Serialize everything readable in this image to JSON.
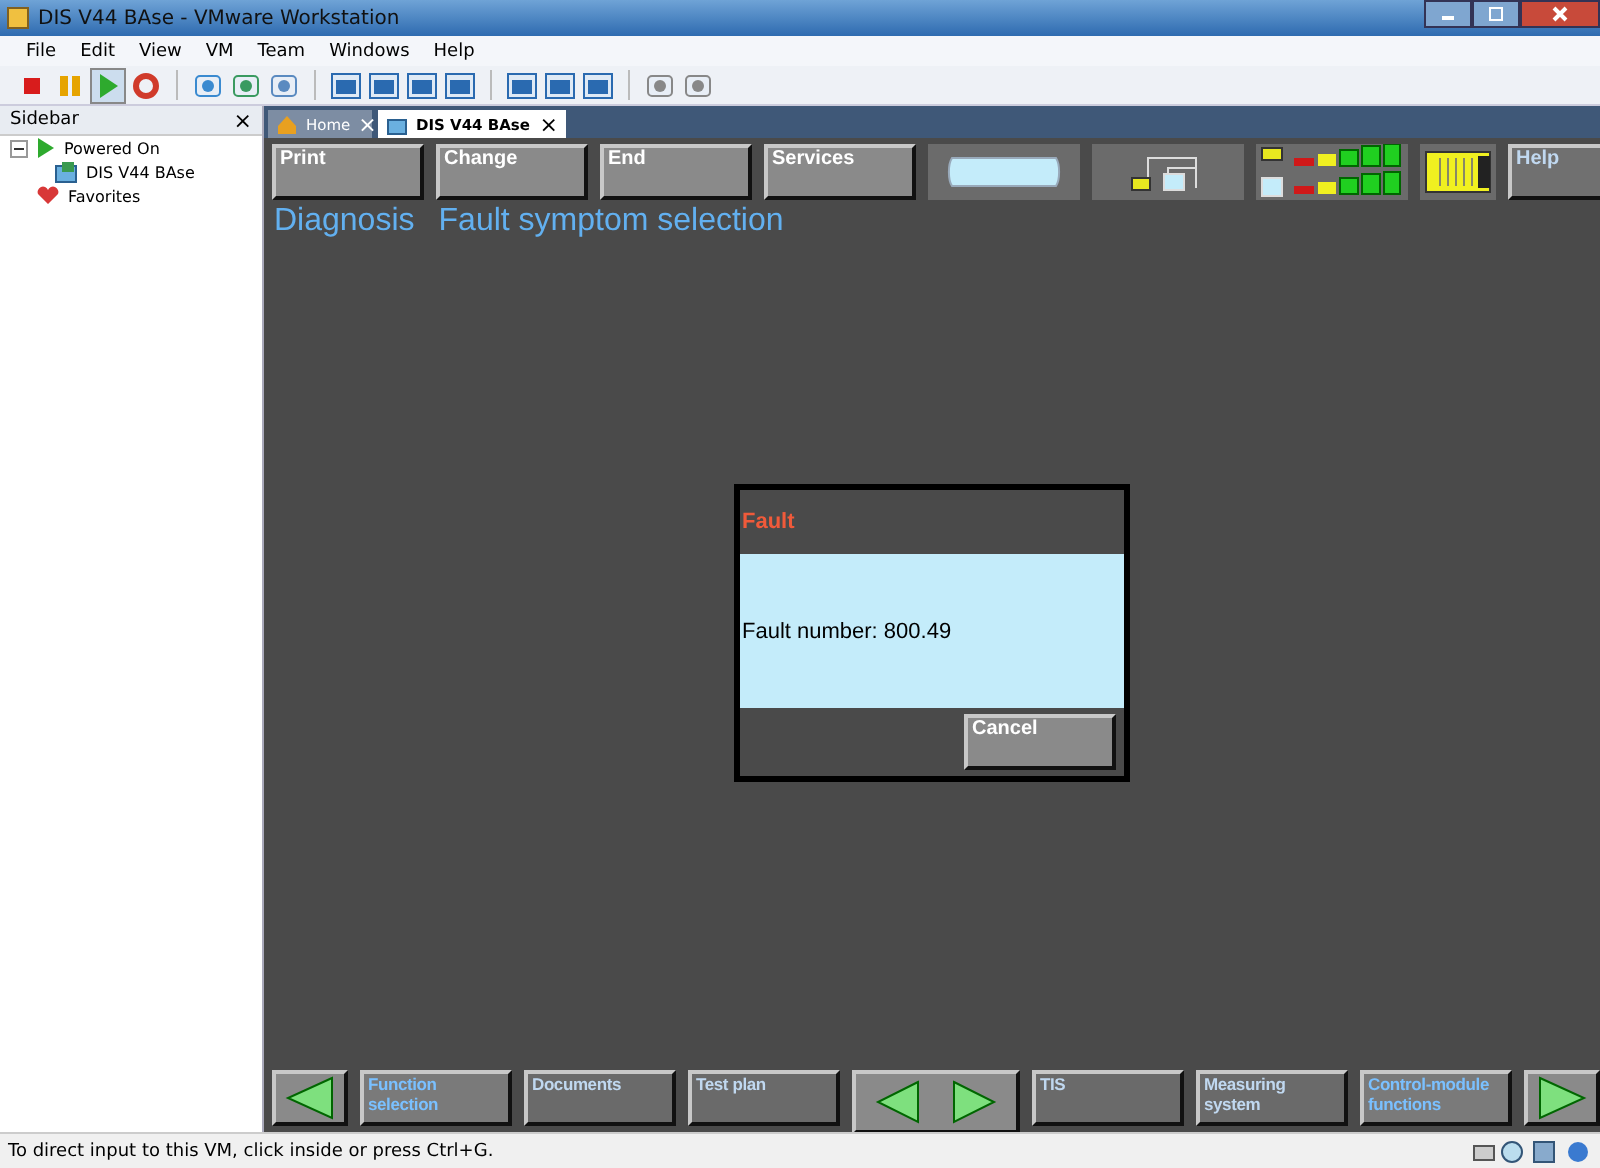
{
  "window": {
    "title": "DIS V44 BAse - VMware Workstation"
  },
  "menu": [
    "File",
    "Edit",
    "View",
    "VM",
    "Team",
    "Windows",
    "Help"
  ],
  "sidebar": {
    "title": "Sidebar",
    "close": "×",
    "tree": [
      {
        "label": "Powered On",
        "expanded": true,
        "children": [
          {
            "label": "DIS V44 BAse"
          }
        ]
      },
      {
        "label": "Favorites"
      }
    ]
  },
  "tabs": [
    {
      "label": "Home",
      "selected": false,
      "close": "×"
    },
    {
      "label": "DIS V44 BAse",
      "selected": true,
      "close": "×"
    }
  ],
  "dis": {
    "top_buttons": [
      {
        "kind": "text",
        "label": "Print",
        "disabled": false
      },
      {
        "kind": "text",
        "label": "Change",
        "disabled": false
      },
      {
        "kind": "text",
        "label": "End",
        "disabled": false
      },
      {
        "kind": "text",
        "label": "Services",
        "disabled": false
      },
      {
        "kind": "tube"
      },
      {
        "kind": "network"
      },
      {
        "kind": "signal"
      },
      {
        "kind": "connector"
      },
      {
        "kind": "text",
        "label": "Help",
        "disabled": true
      }
    ],
    "heading": [
      "Diagnosis",
      "Fault symptom selection"
    ],
    "dialog": {
      "title": "Fault",
      "message": "Fault number: 800.49",
      "button": "Cancel"
    },
    "bottom_buttons": [
      {
        "kind": "back"
      },
      {
        "kind": "text",
        "label": "Function selection",
        "disabled": false
      },
      {
        "kind": "text",
        "label": "Documents",
        "disabled": true
      },
      {
        "kind": "text",
        "label": "Test plan",
        "disabled": true
      },
      {
        "kind": "pair"
      },
      {
        "kind": "text",
        "label": "TIS",
        "disabled": true
      },
      {
        "kind": "text",
        "label": "Measuring system",
        "disabled": true
      },
      {
        "kind": "text",
        "label": "Control-module functions",
        "disabled": false
      },
      {
        "kind": "forward"
      }
    ]
  },
  "status_bar": {
    "text": "To direct input to this VM, click inside or press Ctrl+G."
  }
}
